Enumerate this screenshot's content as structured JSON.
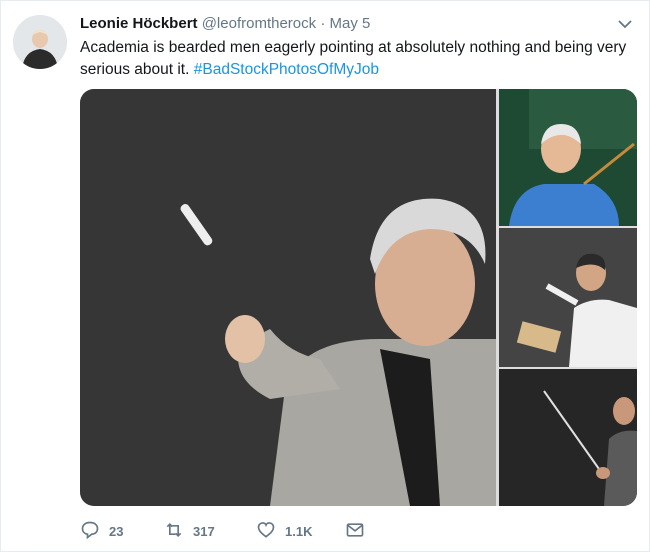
{
  "tweet": {
    "author_name": "Leonie Höckbert",
    "handle": "@leofromtherock",
    "separator": "·",
    "time": "May 5",
    "text": "Academia is bearded men eagerly pointing at absolutely nothing and being very serious about it.",
    "hashtag": "#BadStockPhotosOfMyJob"
  },
  "actions": {
    "replies": "23",
    "retweets": "317",
    "likes": "1.1K"
  },
  "icons": {
    "menu": "chevron-down-icon",
    "reply": "reply-icon",
    "retweet": "retweet-icon",
    "like": "heart-icon",
    "message": "envelope-icon"
  },
  "colors": {
    "link": "#1b95e0",
    "secondary_text": "#657786",
    "primary_text": "#14171a"
  }
}
